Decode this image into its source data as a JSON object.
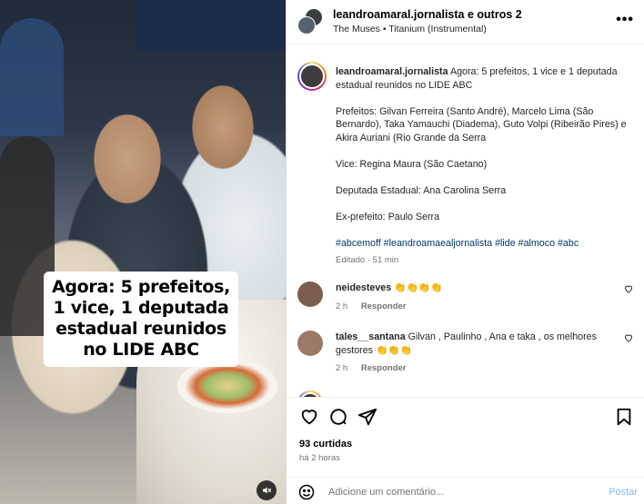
{
  "media": {
    "caption_lines": [
      "Agora: 5 prefeitos,",
      "1 vice, 1 deputada",
      "estadual reunidos",
      "no LIDE ABC"
    ],
    "mute_icon": "speaker-muted-icon"
  },
  "header": {
    "username": "leandroamaral.jornalista e outros 2",
    "music": "The Muses • Titanium (Instrumental)",
    "more_icon": "ellipsis-icon"
  },
  "post": {
    "author": "leandroamaral.jornalista",
    "lead": "Agora: 5 prefeitos, 1 vice e 1 deputada estadual reunidos no LIDE ABC",
    "prefeitos": "Prefeitos: Gilvan Ferreira (Santo André), Marcelo Lima (São Bernardo), Taka Yamauchi (Diadema), Guto Volpi (Ribeirão Pires) e Akira Auriani (Rio Grande da Serra",
    "vice": "Vice: Regina Maura (São Caetano)",
    "deputada": "Deputada Estadual: Ana Carolina Serra",
    "ex_prefeito": "Ex-prefeito: Paulo Serra",
    "hashtags": "#abcemoff #leandroamaealjornalista #lide #almoco #abc",
    "edited": "Editado · 51 min"
  },
  "comments": [
    {
      "user": "neidesteves",
      "text": "👏👏👏👏",
      "time": "2 h",
      "reply": "Responder"
    },
    {
      "user": "tales__santana",
      "text": "Gilvan , Paulinho , Ana e taka , os melhores gestores 👏👏👏",
      "time": "2 h",
      "reply": "Responder"
    }
  ],
  "stats": {
    "likes": "93 curtidas",
    "posted": "há 2 horas"
  },
  "composer": {
    "placeholder": "Adicione um comentário...",
    "post_label": "Postar"
  },
  "colors": {
    "link": "#00376b",
    "post_button": "#87b7f5",
    "muted_text": "#737373"
  }
}
